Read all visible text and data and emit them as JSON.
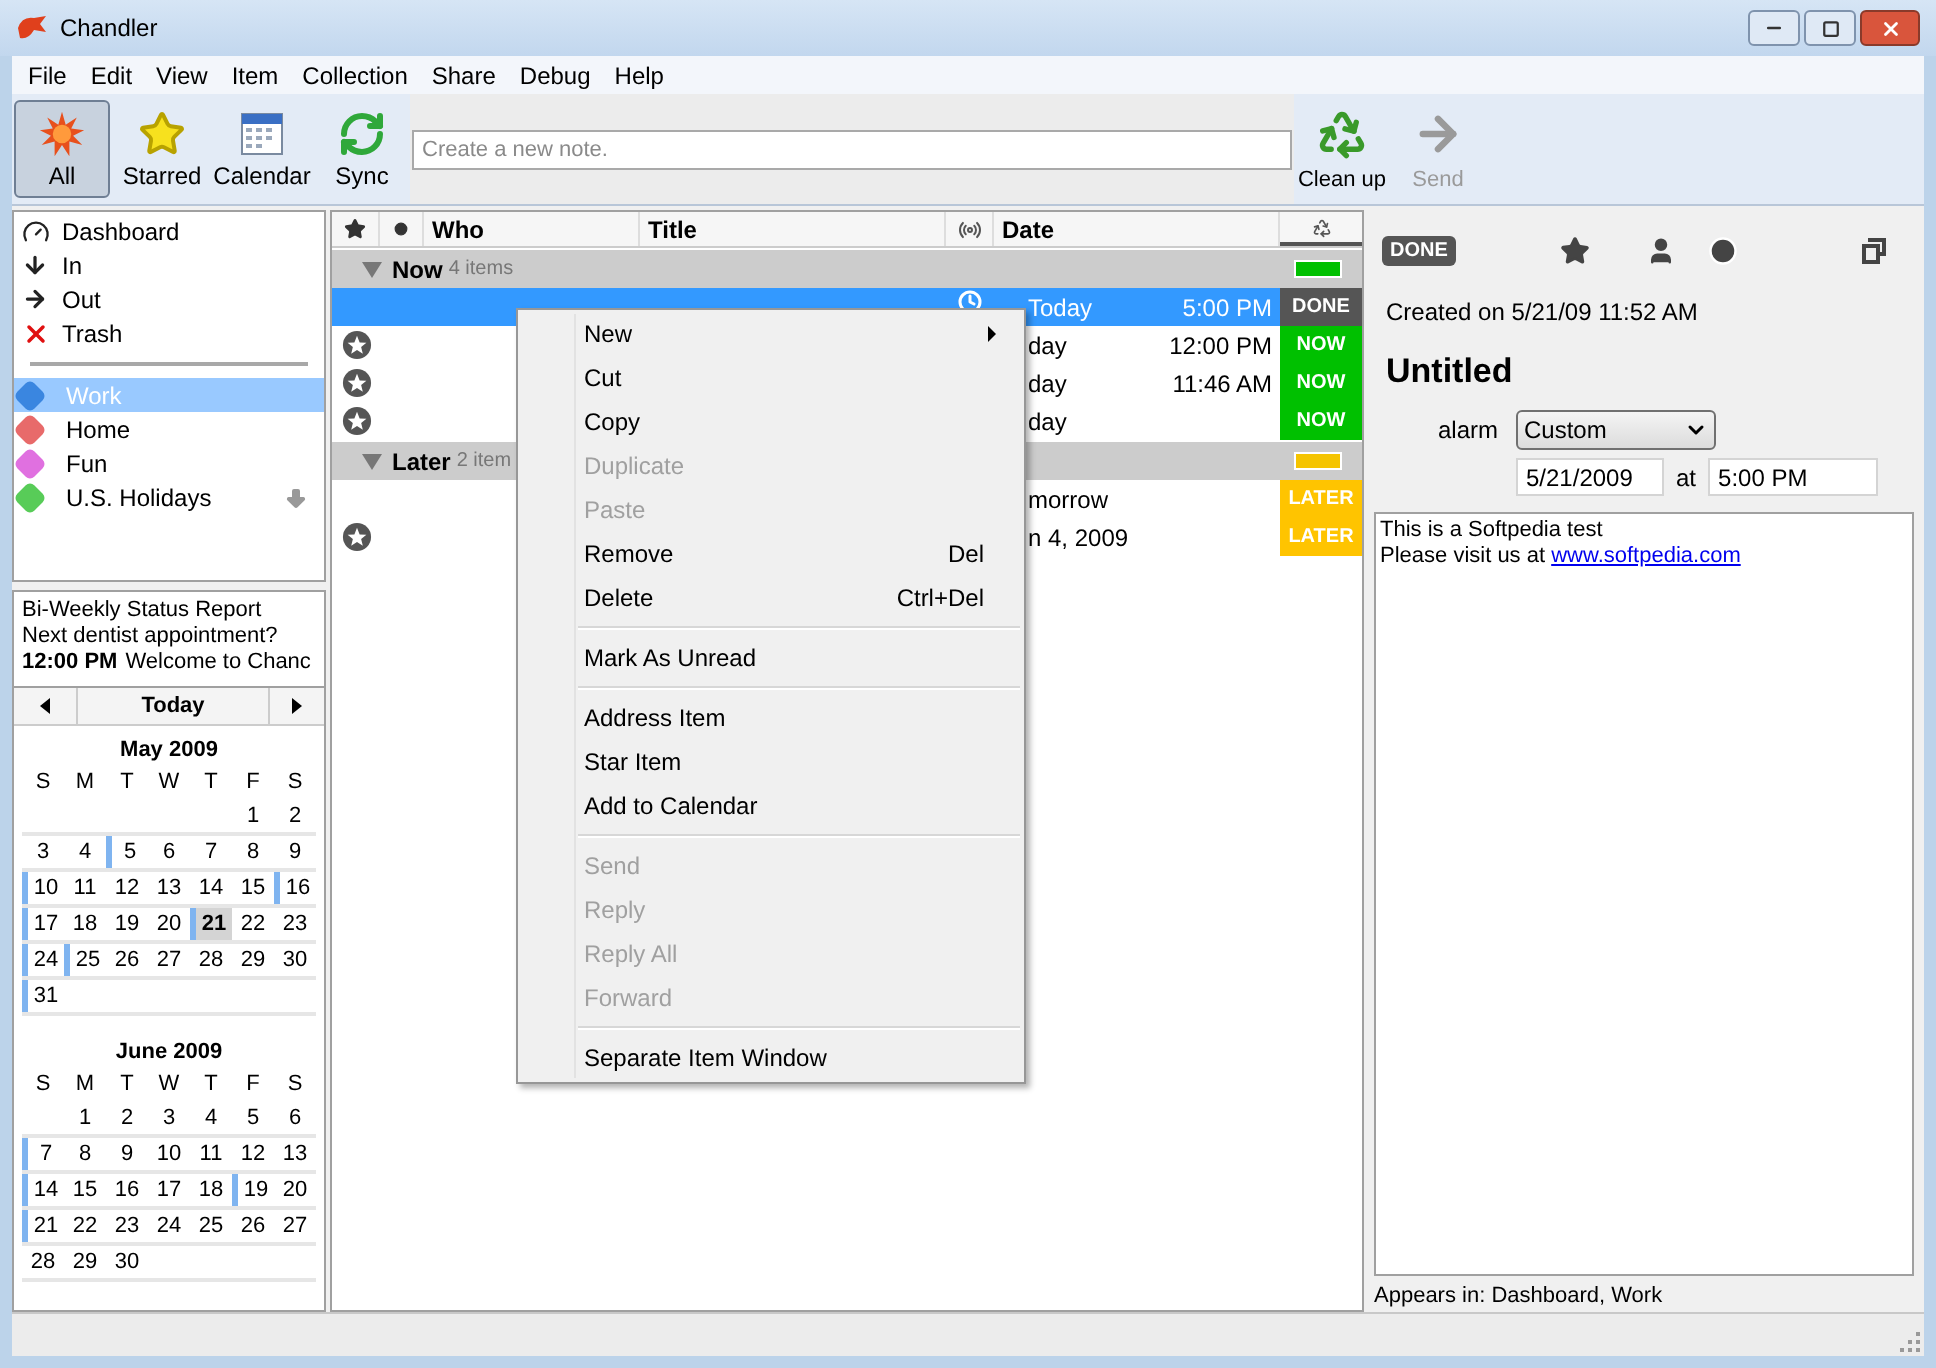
{
  "window": {
    "title": "Chandler"
  },
  "menu_bar": [
    "File",
    "Edit",
    "View",
    "Item",
    "Collection",
    "Share",
    "Debug",
    "Help"
  ],
  "toolbar": {
    "buttons": [
      {
        "kind": "all",
        "label": "All",
        "selected": true
      },
      {
        "kind": "starred",
        "label": "Starred",
        "selected": false
      },
      {
        "kind": "calendar",
        "label": "Calendar",
        "selected": false
      },
      {
        "kind": "sync",
        "label": "Sync",
        "selected": false
      }
    ],
    "search": {
      "placeholder": "Create a new note."
    },
    "right_buttons": [
      {
        "kind": "cleanup",
        "label": "Clean up",
        "disabled": false
      },
      {
        "kind": "send",
        "label": "Send",
        "disabled": true
      }
    ]
  },
  "sidebar": {
    "collections": [
      {
        "kind": "dashboard",
        "label": "Dashboard"
      },
      {
        "kind": "in",
        "label": "In"
      },
      {
        "kind": "out",
        "label": "Out"
      },
      {
        "kind": "trash",
        "label": "Trash"
      }
    ],
    "user_collections": [
      {
        "label": "Work",
        "color": "#3a86e0",
        "selected": true,
        "subscribed": false
      },
      {
        "label": "Home",
        "color": "#e86a6a",
        "selected": false,
        "subscribed": false
      },
      {
        "label": "Fun",
        "color": "#e070e0",
        "selected": false,
        "subscribed": false
      },
      {
        "label": "U.S. Holidays",
        "color": "#58cc58",
        "selected": false,
        "subscribed": true
      }
    ],
    "previews": [
      {
        "text": "Bi-Weekly Status Report"
      },
      {
        "text": "Next dentist appointment?"
      },
      {
        "time": "12:00 PM",
        "text": "Welcome to Chanc"
      }
    ]
  },
  "calendar": {
    "today": "Today",
    "months": [
      {
        "title": "May 2009",
        "weekdays": [
          "S",
          "M",
          "T",
          "W",
          "T",
          "F",
          "S"
        ],
        "weeks": [
          [
            {
              "day": "1",
              "marked": false,
              "selected": false
            },
            {
              "day": "2",
              "marked": false,
              "selected": false
            }
          ],
          [
            {
              "day": "3",
              "marked": false,
              "selected": false
            },
            {
              "day": "4",
              "marked": false,
              "selected": false
            },
            {
              "day": "5",
              "marked": true,
              "selected": false
            },
            {
              "day": "6",
              "marked": false,
              "selected": false
            },
            {
              "day": "7",
              "marked": false,
              "selected": false
            },
            {
              "day": "8",
              "marked": false,
              "selected": false
            },
            {
              "day": "9",
              "marked": false,
              "selected": false
            }
          ],
          [
            {
              "day": "10",
              "marked": true,
              "selected": false
            },
            {
              "day": "11",
              "marked": false,
              "selected": false
            },
            {
              "day": "12",
              "marked": false,
              "selected": false
            },
            {
              "day": "13",
              "marked": false,
              "selected": false
            },
            {
              "day": "14",
              "marked": false,
              "selected": false
            },
            {
              "day": "15",
              "marked": false,
              "selected": false
            },
            {
              "day": "16",
              "marked": true,
              "selected": false
            }
          ],
          [
            {
              "day": "17",
              "marked": true,
              "selected": false
            },
            {
              "day": "18",
              "marked": false,
              "selected": false
            },
            {
              "day": "19",
              "marked": false,
              "selected": false
            },
            {
              "day": "20",
              "marked": false,
              "selected": false
            },
            {
              "day": "21",
              "marked": true,
              "selected": true
            },
            {
              "day": "22",
              "marked": false,
              "selected": false
            },
            {
              "day": "23",
              "marked": false,
              "selected": false
            }
          ],
          [
            {
              "day": "24",
              "marked": true,
              "selected": false
            },
            {
              "day": "25",
              "marked": true,
              "selected": false
            },
            {
              "day": "26",
              "marked": false,
              "selected": false
            },
            {
              "day": "27",
              "marked": false,
              "selected": false
            },
            {
              "day": "28",
              "marked": false,
              "selected": false
            },
            {
              "day": "29",
              "marked": false,
              "selected": false
            },
            {
              "day": "30",
              "marked": false,
              "selected": false
            }
          ],
          [
            {
              "day": "31",
              "marked": true,
              "selected": false
            }
          ]
        ]
      },
      {
        "title": "June 2009",
        "weekdays": [
          "S",
          "M",
          "T",
          "W",
          "T",
          "F",
          "S"
        ],
        "weeks": [
          [
            {
              "day": "1",
              "marked": false,
              "selected": false
            },
            {
              "day": "2",
              "marked": false,
              "selected": false
            },
            {
              "day": "3",
              "marked": false,
              "selected": false
            },
            {
              "day": "4",
              "marked": false,
              "selected": false
            },
            {
              "day": "5",
              "marked": false,
              "selected": false
            },
            {
              "day": "6",
              "marked": false,
              "selected": false
            }
          ],
          [
            {
              "day": "7",
              "marked": true,
              "selected": false
            },
            {
              "day": "8",
              "marked": false,
              "selected": false
            },
            {
              "day": "9",
              "marked": false,
              "selected": false
            },
            {
              "day": "10",
              "marked": false,
              "selected": false
            },
            {
              "day": "11",
              "marked": false,
              "selected": false
            },
            {
              "day": "12",
              "marked": false,
              "selected": false
            },
            {
              "day": "13",
              "marked": false,
              "selected": false
            }
          ],
          [
            {
              "day": "14",
              "marked": true,
              "selected": false
            },
            {
              "day": "15",
              "marked": false,
              "selected": false
            },
            {
              "day": "16",
              "marked": false,
              "selected": false
            },
            {
              "day": "17",
              "marked": false,
              "selected": false
            },
            {
              "day": "18",
              "marked": false,
              "selected": false
            },
            {
              "day": "19",
              "marked": true,
              "selected": false
            },
            {
              "day": "20",
              "marked": false,
              "selected": false
            }
          ],
          [
            {
              "day": "21",
              "marked": true,
              "selected": false
            },
            {
              "day": "22",
              "marked": false,
              "selected": false
            },
            {
              "day": "23",
              "marked": false,
              "selected": false
            },
            {
              "day": "24",
              "marked": false,
              "selected": false
            },
            {
              "day": "25",
              "marked": false,
              "selected": false
            },
            {
              "day": "26",
              "marked": false,
              "selected": false
            },
            {
              "day": "27",
              "marked": false,
              "selected": false
            }
          ],
          [
            {
              "day": "28",
              "marked": false,
              "selected": false
            },
            {
              "day": "29",
              "marked": false,
              "selected": false
            },
            {
              "day": "30",
              "marked": false,
              "selected": false
            }
          ]
        ]
      }
    ]
  },
  "table": {
    "columns": [
      "Who",
      "Title",
      "Date"
    ],
    "sections": [
      {
        "label": "Now",
        "count": "4 items",
        "color": "#00c000",
        "rows": [
          {
            "selected": true,
            "task": false,
            "alarm": true,
            "date": "Today",
            "time": "5:00 PM",
            "status": "DONE",
            "color": "#555555"
          },
          {
            "selected": false,
            "task": true,
            "date": "day",
            "time": "12:00 PM",
            "status": "NOW",
            "color": "#00c000"
          },
          {
            "selected": false,
            "task": true,
            "date": "day",
            "time": "11:46 AM",
            "status": "NOW",
            "color": "#00c000"
          },
          {
            "selected": false,
            "task": true,
            "date": "day",
            "status": "NOW",
            "color": "#00c000"
          }
        ]
      },
      {
        "label": "Later",
        "count": "2 item",
        "color": "#f5c400",
        "rows": [
          {
            "selected": false,
            "task": false,
            "date": "morrow",
            "status": "LATER",
            "color": "#ffc400"
          },
          {
            "selected": false,
            "task": true,
            "date": "n 4, 2009",
            "status": "LATER",
            "color": "#ffc400"
          }
        ]
      }
    ]
  },
  "context_menu": {
    "groups": [
      [
        {
          "label": "New",
          "submenu": true,
          "disabled": false
        },
        {
          "label": "Cut",
          "submenu": false,
          "disabled": false
        },
        {
          "label": "Copy",
          "submenu": false,
          "disabled": false
        },
        {
          "label": "Duplicate",
          "submenu": false,
          "disabled": true
        },
        {
          "label": "Paste",
          "submenu": false,
          "disabled": true
        },
        {
          "label": "Remove",
          "shortcut": "Del",
          "submenu": false,
          "disabled": false
        },
        {
          "label": "Delete",
          "shortcut": "Ctrl+Del",
          "submenu": false,
          "disabled": false
        }
      ],
      [
        {
          "label": "Mark As Unread",
          "submenu": false,
          "disabled": false
        }
      ],
      [
        {
          "label": "Address Item",
          "submenu": false,
          "disabled": false
        },
        {
          "label": "Star Item",
          "submenu": false,
          "disabled": false
        },
        {
          "label": "Add to Calendar",
          "submenu": false,
          "disabled": false
        }
      ],
      [
        {
          "label": "Send",
          "submenu": false,
          "disabled": true
        },
        {
          "label": "Reply",
          "submenu": false,
          "disabled": true
        },
        {
          "label": "Reply All",
          "submenu": false,
          "disabled": true
        },
        {
          "label": "Forward",
          "submenu": false,
          "disabled": true
        }
      ],
      [
        {
          "label": "Separate Item Window",
          "submenu": false,
          "disabled": false
        }
      ]
    ]
  },
  "detail": {
    "status": "DONE",
    "created": "Created on 5/21/09 11:52 AM",
    "title": "Untitled",
    "alarm": {
      "label": "alarm",
      "value": "Custom"
    },
    "date": "5/21/2009",
    "at": "at",
    "time": "5:00 PM",
    "notes": [
      {
        "text": "This is a Softpedia test"
      },
      {
        "text": "Please visit us at ",
        "link": "www.softpedia.com"
      }
    ],
    "appears_in": "Appears in: Dashboard, Work"
  }
}
